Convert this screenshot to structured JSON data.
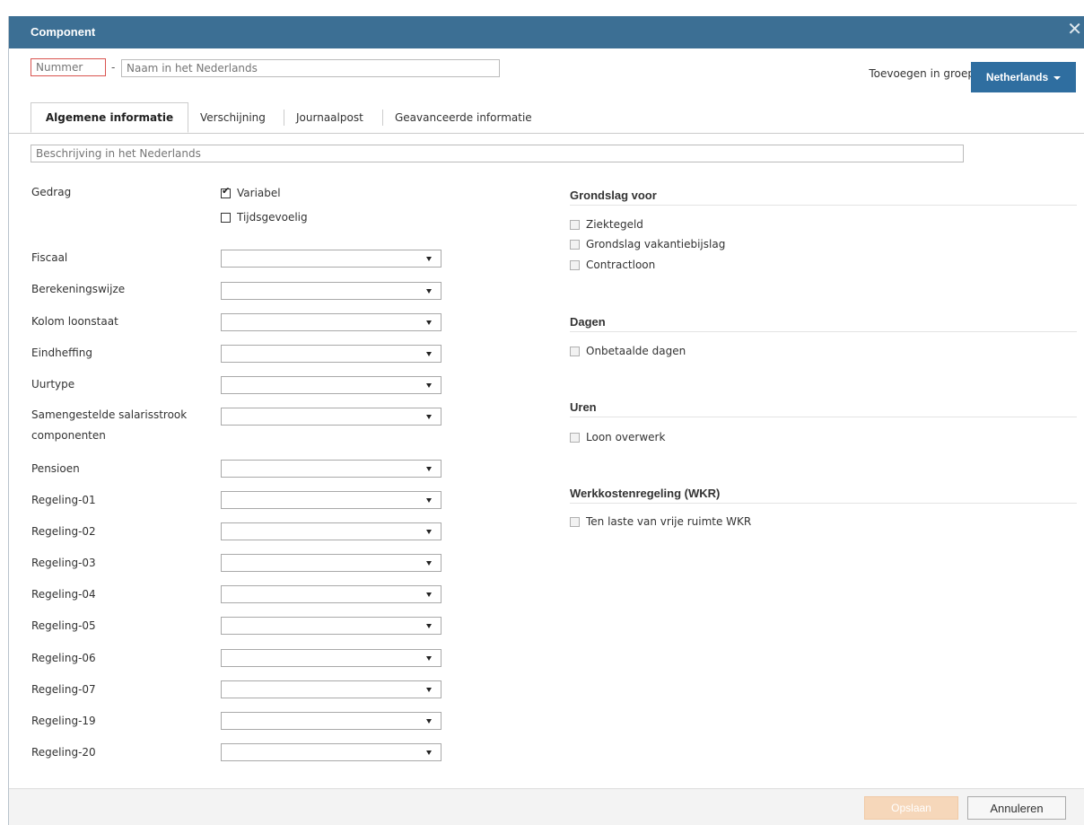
{
  "dialog": {
    "title": "Component",
    "close_icon": "close-icon"
  },
  "top": {
    "number_placeholder": "Nummer",
    "dash": "-",
    "name_placeholder": "Naam in het Nederlands",
    "group_label": "Toevoegen in groep",
    "group_button": "Netherlands"
  },
  "tabs": [
    "Algemene informatie",
    "Verschijning",
    "Journaalpost",
    "Geavanceerde informatie"
  ],
  "description_placeholder": "Beschrijving in het Nederlands",
  "gedrag": {
    "label": "Gedrag",
    "options": [
      {
        "label": "Variabel",
        "checked": true
      },
      {
        "label": "Tijdsgevoelig",
        "checked": false
      }
    ]
  },
  "fields": [
    "Fiscaal",
    "Berekeningswijze",
    "Kolom loonstaat",
    "Eindheffing",
    "Uurtype",
    "Samengestelde salarisstrook componenten",
    "Pensioen",
    "Regeling-01",
    "Regeling-02",
    "Regeling-03",
    "Regeling-04",
    "Regeling-05",
    "Regeling-06",
    "Regeling-07",
    "Regeling-19",
    "Regeling-20"
  ],
  "sections": [
    {
      "title": "Grondslag voor",
      "items": [
        "Ziektegeld",
        "Grondslag vakantiebijslag",
        "Contractloon"
      ]
    },
    {
      "title": "Dagen",
      "items": [
        "Onbetaalde dagen"
      ]
    },
    {
      "title": "Uren",
      "items": [
        "Loon overwerk"
      ]
    },
    {
      "title": "Werkkostenregeling (WKR)",
      "items": [
        "Ten laste van vrije ruimte WKR"
      ]
    }
  ],
  "footer": {
    "save": "Opslaan",
    "cancel": "Annuleren"
  },
  "colors": {
    "header": "#3c6f94",
    "group_button": "#2f6ea0",
    "save_disabled": "#f6d7ba"
  }
}
